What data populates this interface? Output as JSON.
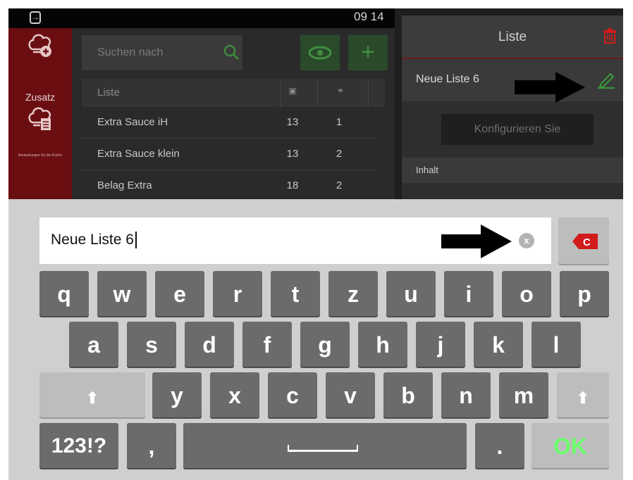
{
  "status": {
    "time": "09 14",
    "exit_icon": "exit-icon"
  },
  "leftnav": {
    "zusatz_label": "Zusatz",
    "kitchen_label": "Anmerkungen für die Küche"
  },
  "search": {
    "placeholder": "Suchen nach"
  },
  "table": {
    "header": {
      "name": "Liste"
    },
    "rows": [
      {
        "name": "Extra Sauce iH",
        "col1": "13",
        "col2": "1"
      },
      {
        "name": "Extra Sauce klein",
        "col1": "13",
        "col2": "2"
      },
      {
        "name": "Belag Extra",
        "col1": "18",
        "col2": "2"
      }
    ]
  },
  "panel": {
    "title": "Liste",
    "list_name": "Neue Liste 6",
    "configure_label": "Konfigurieren Sie",
    "content_label": "Inhalt"
  },
  "keyboard": {
    "input_value": "Neue Liste 6",
    "clear_glyph": "x",
    "backspace_glyph": "C",
    "row1": [
      "q",
      "w",
      "e",
      "r",
      "t",
      "z",
      "u",
      "i",
      "o",
      "p"
    ],
    "row2": [
      "a",
      "s",
      "d",
      "f",
      "g",
      "h",
      "j",
      "k",
      "l"
    ],
    "row3": [
      "y",
      "x",
      "c",
      "v",
      "b",
      "n",
      "m"
    ],
    "shift_glyph": "⬆",
    "numbers_label": "123!?",
    "comma_label": ",",
    "period_label": ".",
    "ok_label": "OK"
  },
  "colors": {
    "accent_red": "#6b0e12",
    "ok_green": "#6dff6d",
    "delete_red": "#d21b1b"
  }
}
